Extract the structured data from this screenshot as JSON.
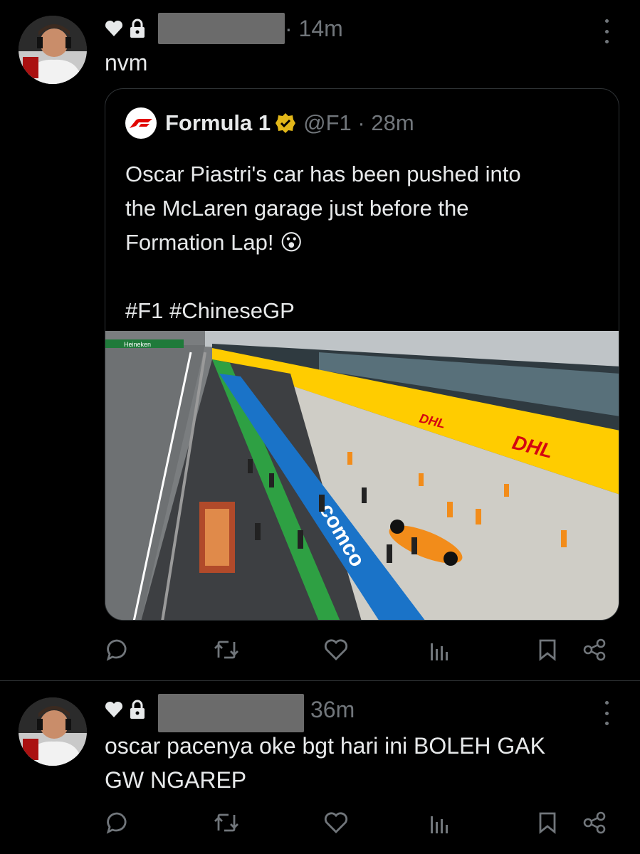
{
  "tweet1": {
    "time": "· 14m",
    "text": "nvm",
    "icons": {
      "heart": "heart-icon",
      "lock": "lock-icon",
      "more": "more-icon"
    },
    "quote": {
      "name": "Formula 1",
      "handle": "@F1 · 28m",
      "text": "Oscar Piastri's car has been pushed into\nthe McLaren garage just before the\nFormation Lap! 😮\n\n#F1 #ChineseGP",
      "image": {
        "sign_heineken": "Heineken",
        "sign_dhl": "DHL",
        "sign_comco": "comco"
      }
    }
  },
  "tweet2": {
    "time": "36m",
    "text": "oscar pacenya oke bgt hari ini BOLEH GAK\nGW NGAREP"
  },
  "actions": [
    "reply-icon",
    "retweet-icon",
    "like-icon",
    "views-icon",
    "bookmark-icon",
    "share-icon"
  ],
  "colors": {
    "background": "#000000",
    "text": "#e7e9ea",
    "muted": "#71767b",
    "border": "#2f3336",
    "verified": "#e2b719",
    "f1_red": "#e10600",
    "dhl_yellow": "#ffcc00"
  }
}
